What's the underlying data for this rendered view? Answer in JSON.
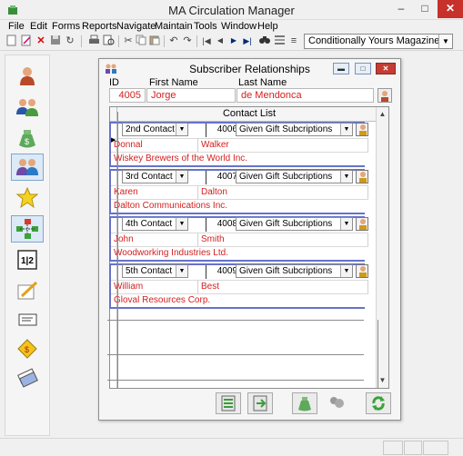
{
  "window": {
    "title": "MA Circulation Manager"
  },
  "menu": [
    "File",
    "Edit",
    "Forms",
    "Reports",
    "Navigate",
    "Maintain",
    "Tools",
    "Window",
    "Help"
  ],
  "toolbar": {
    "publication_select": "Conditionally Yours Magazine"
  },
  "dialog": {
    "title": "Subscriber Relationships",
    "labels": {
      "id": "ID",
      "first": "First Name",
      "last": "Last Name"
    },
    "subscriber": {
      "id": "4005",
      "first_name": "Jorge",
      "last_name": "de Mendonca"
    },
    "contact_list_header": "Contact List"
  },
  "contacts": [
    {
      "type": "2nd Contact",
      "id": "4006",
      "relationship": "Given Gift Subcriptions",
      "first_name": "Donnal",
      "last_name": "Walker",
      "company": "Wiskey Brewers of the World Inc."
    },
    {
      "type": "3rd Contact",
      "id": "4007",
      "relationship": "Given Gift Subcriptions",
      "first_name": "Karen",
      "last_name": "Dalton",
      "company": "Dalton Communications Inc."
    },
    {
      "type": "4th Contact",
      "id": "4008",
      "relationship": "Given Gift Subcriptions",
      "first_name": "John",
      "last_name": "Smith",
      "company": "Woodworking Industries Ltd."
    },
    {
      "type": "5th Contact",
      "id": "4009",
      "relationship": "Given Gift Subcriptions",
      "first_name": "William",
      "last_name": "Best",
      "company": "Gloval Resources Corp."
    }
  ],
  "colors": {
    "accent_red": "#d42020",
    "record_border": "#6573c9",
    "close_red": "#c7302b"
  },
  "icons": {
    "sidebar": [
      "person-icon",
      "people-group-icon",
      "money-bag-icon",
      "relationships-icon",
      "star-burst-icon",
      "org-chart-icon",
      "calendar-icon",
      "pencil-paper-icon",
      "label-icon",
      "gift-coupon-icon",
      "tickets-icon"
    ]
  }
}
